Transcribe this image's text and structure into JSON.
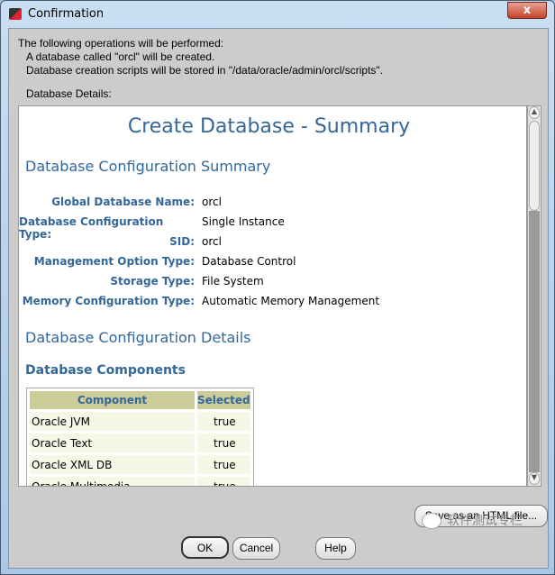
{
  "window": {
    "title": "Confirmation",
    "close": "x"
  },
  "message": {
    "intro": "The following operations will be performed:",
    "line1": "A database called \"orcl\" will be created.",
    "line2": "Database creation scripts will be stored in \"/data/oracle/admin/orcl/scripts\".",
    "details_label": "Database Details:"
  },
  "summary": {
    "title": "Create Database - Summary",
    "config_heading": "Database Configuration Summary",
    "fields": [
      {
        "label": "Global Database Name:",
        "value": "orcl"
      },
      {
        "label": "Database Configuration Type:",
        "value": "Single Instance"
      },
      {
        "label": "SID:",
        "value": "orcl"
      },
      {
        "label": "Management Option Type:",
        "value": "Database Control"
      },
      {
        "label": "Storage Type:",
        "value": "File System"
      },
      {
        "label": "Memory Configuration Type:",
        "value": "Automatic Memory Management"
      }
    ],
    "details_heading": "Database Configuration Details",
    "components_heading": "Database Components",
    "table": {
      "headers": [
        "Component",
        "Selected"
      ],
      "rows": [
        [
          "Oracle JVM",
          "true"
        ],
        [
          "Oracle Text",
          "true"
        ],
        [
          "Oracle XML DB",
          "true"
        ],
        [
          "Oracle Multimedia",
          "true"
        ]
      ]
    }
  },
  "buttons": {
    "save_html": "Save as an HTML file...",
    "ok": "OK",
    "cancel": "Cancel",
    "help": "Help"
  },
  "watermark": "软件测试专栏",
  "colors": {
    "heading": "#336699",
    "table_header": "#cccc99",
    "table_cell": "#f7f7e7"
  }
}
